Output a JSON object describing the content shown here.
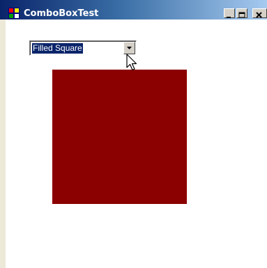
{
  "window": {
    "title": "ComboBoxTest",
    "icon": "app-icon",
    "controls": [
      "minimize-icon",
      "maximize-icon",
      "close-icon"
    ]
  },
  "combobox": {
    "selected": "Filled Square",
    "dropdown_icon": "chevron-down-icon"
  },
  "canvas": {
    "shape": "filled-square-shape",
    "fill_color": "#8b0000"
  },
  "colors": {
    "titlebar_start": "#0a246a",
    "titlebar_end": "#a6caf0",
    "selection": "#0a246a",
    "shape": "#8b0000"
  }
}
